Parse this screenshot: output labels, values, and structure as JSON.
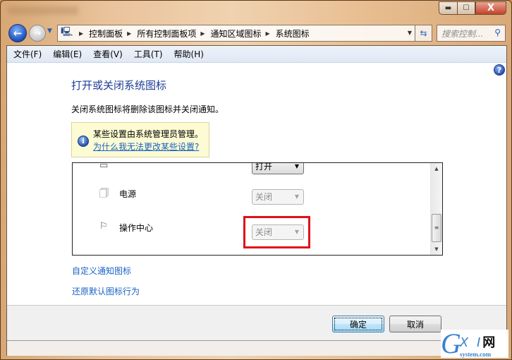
{
  "window": {
    "caption_buttons": {
      "minimize_icon": "minimize-icon",
      "maximize_icon": "maximize-icon",
      "close_icon": "close-icon",
      "minimize_glyph": "▬",
      "maximize_glyph": "☐",
      "close_glyph": "X"
    }
  },
  "navigation": {
    "back_glyph": "←",
    "forward_glyph": "→",
    "history_glyph": "▼",
    "breadcrumb": [
      "控制面板",
      "所有控制面板项",
      "通知区域图标",
      "系统图标"
    ],
    "crumb_separator": "▶",
    "address_dropdown_glyph": "▼",
    "refresh_glyph": "⇆",
    "search_placeholder": "搜索控制...",
    "search_glyph": "⚲"
  },
  "menubar": {
    "items": [
      "文件(F)",
      "编辑(E)",
      "查看(V)",
      "工具(T)",
      "帮助(H)"
    ]
  },
  "help_glyph": "?",
  "page": {
    "title": "打开或关闭系统图标",
    "description": "关闭系统图标将删除该图标并关闭通知。"
  },
  "infobar": {
    "icon_glyph": "i",
    "message": "某些设置由系统管理员管理。",
    "link": "为什么我无法更改某些设置?"
  },
  "icon_list": {
    "rows": [
      {
        "label": "",
        "icon": "partial-icon",
        "glyph": "▭",
        "value": "打开",
        "enabled": true
      },
      {
        "label": "电源",
        "icon": "power-plug-icon",
        "glyph": "🗍",
        "value": "关闭",
        "enabled": false
      },
      {
        "label": "操作中心",
        "icon": "flag-icon",
        "glyph": "⚐",
        "value": "关闭",
        "enabled": false,
        "highlighted": true
      }
    ],
    "dropdown_glyph": "▼",
    "scroll_up_glyph": "▲",
    "scroll_down_glyph": "▼",
    "scroll_thumb_glyph": "≡"
  },
  "links": {
    "customize": "自定义通知图标",
    "restore": "还原默认图标行为"
  },
  "buttons": {
    "ok": "确定",
    "cancel": "取消"
  },
  "watermark": {
    "g": "G",
    "xi": "X I",
    "wang": "网",
    "domain": "system.com"
  }
}
